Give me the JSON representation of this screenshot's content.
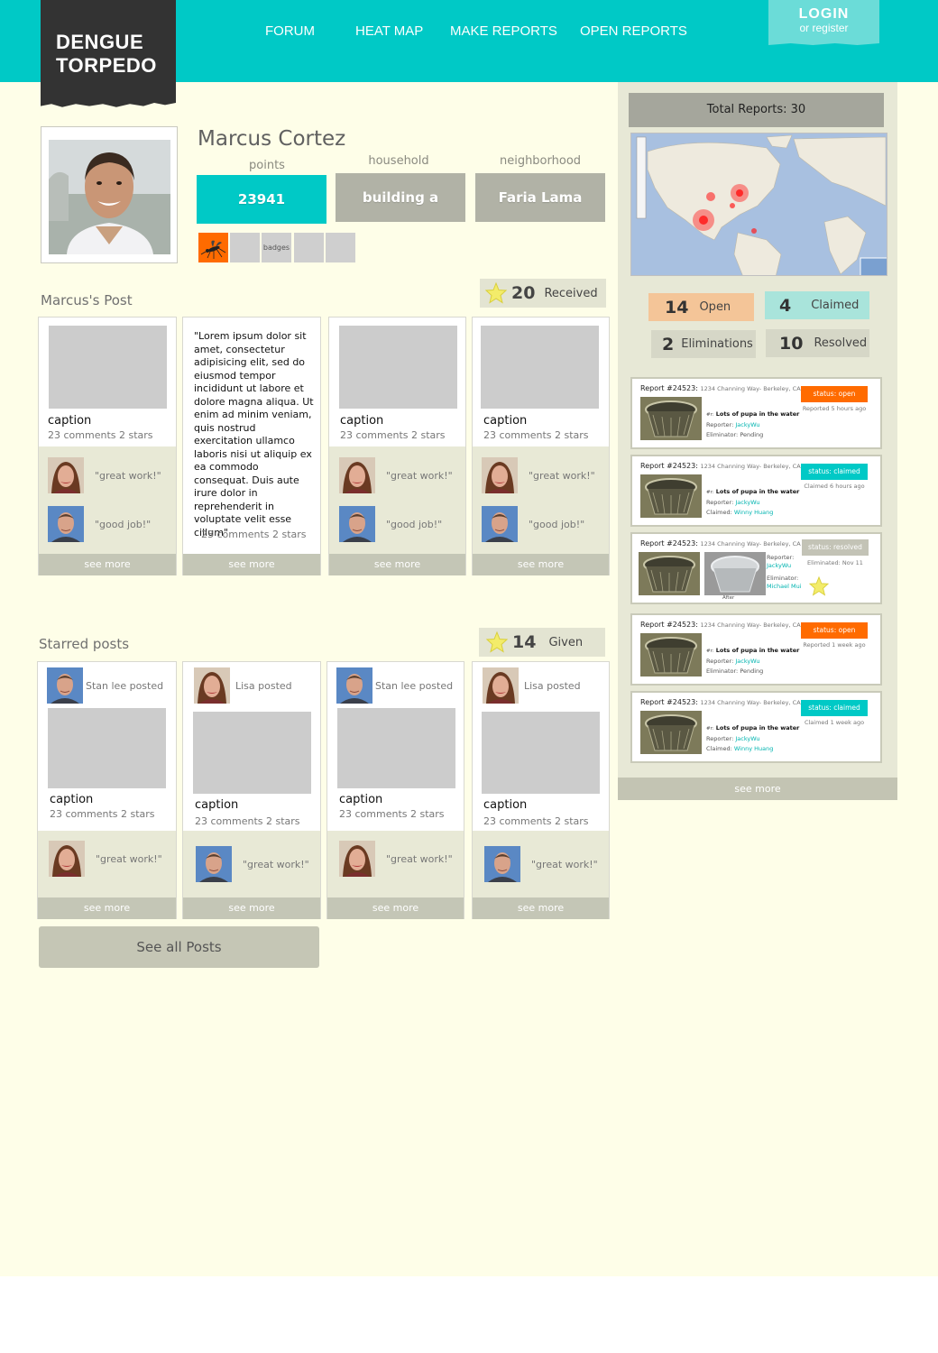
{
  "header": {
    "logo_line1": "DENGUE",
    "logo_line2": "TORPEDO",
    "nav": [
      "FORUM",
      "HEAT MAP",
      "MAKE REPORTS",
      "OPEN REPORTS"
    ],
    "login_label": "LOGIN",
    "register_label": "or register"
  },
  "profile": {
    "name": "Marcus Cortez",
    "points_label": "points",
    "points_value": "23941",
    "household_label": "household",
    "household_value": "building a",
    "neighborhood_label": "neighborhood",
    "neighborhood_value": "Faria Lama",
    "badges_label": "badges"
  },
  "posts_section": {
    "title": "Marcus's Post",
    "received_count": "20",
    "received_label": "Received"
  },
  "posts": [
    {
      "caption": "caption",
      "meta": "23 comments 2 stars",
      "comments": [
        "\"great work!\"",
        "\"good job!\""
      ],
      "see_more": "see more"
    },
    {
      "quote": "\"Lorem ipsum dolor sit amet, consectetur adipisicing elit, sed do eiusmod tempor incididunt ut labore et dolore magna aliqua. Ut enim ad minim veniam, quis nostrud exercitation ullamco laboris nisi ut aliquip ex ea commodo consequat. Duis aute irure dolor in reprehenderit in voluptate velit esse cillum\"",
      "meta": "23 comments 2 stars",
      "see_more": "see more"
    },
    {
      "caption": "caption",
      "meta": "23 comments 2 stars",
      "comments": [
        "\"great work!\"",
        "\"good job!\""
      ],
      "see_more": "see more"
    },
    {
      "caption": "caption",
      "meta": "23 comments 2 stars",
      "comments": [
        "\"great work!\"",
        "\"good job!\""
      ],
      "see_more": "see more"
    }
  ],
  "starred_section": {
    "title": "Starred posts",
    "given_count": "14",
    "given_label": "Given"
  },
  "starred": [
    {
      "poster": "Stan lee posted",
      "caption": "caption",
      "meta": "23 comments 2 stars",
      "comment": "\"great work!\"",
      "see_more": "see more"
    },
    {
      "poster": "Lisa posted",
      "caption": "caption",
      "meta": "23 comments 2 stars",
      "comment": "\"great work!\"",
      "see_more": "see more"
    },
    {
      "poster": "Stan lee posted",
      "caption": "caption",
      "meta": "23 comments 2 stars",
      "comment": "\"great work!\"",
      "see_more": "see more"
    },
    {
      "poster": "Lisa posted",
      "caption": "caption",
      "meta": "23 comments 2 stars",
      "comment": "\"great work!\"",
      "see_more": "see more"
    }
  ],
  "see_all_posts": "See all Posts",
  "sidebar": {
    "total_reports": "Total Reports: 30",
    "status": {
      "open_count": "14",
      "open_label": "Open",
      "claimed_count": "4",
      "claimed_label": "Claimed",
      "elim_count": "2",
      "elim_label": "Eliminations",
      "resolved_count": "10",
      "resolved_label": "Resolved"
    },
    "reports": [
      {
        "title": "Report #24523:",
        "address": "1234 Channing Way- Berkeley, CA",
        "status": "status: open",
        "when": "Reported 5 hours ago",
        "desc": "Lots of pupa in the water",
        "reporter_label": "Reporter:",
        "reporter": "JackyWu",
        "second_label": "Eliminator:",
        "second": "Pending"
      },
      {
        "title": "Report #24523:",
        "address": "1234 Channing Way- Berkeley, CA",
        "status": "status: claimed",
        "when": "Claimed 6 hours ago",
        "desc": "Lots of pupa in the water",
        "reporter_label": "Reporter:",
        "reporter": "JackyWu",
        "second_label": "Claimed:",
        "second": "Winny Huang"
      },
      {
        "title": "Report #24523:",
        "address": "1234 Channing Way- Berkeley, CA",
        "status": "status: resolved",
        "when": "Eliminated: Nov 11",
        "after_label": "After",
        "reporter_label": "Reporter:",
        "reporter": "JackyWu",
        "second_label": "Eliminator:",
        "second": "Michael Mui"
      },
      {
        "title": "Report #24523:",
        "address": "1234 Channing Way- Berkeley, CA",
        "status": "status: open",
        "when": "Reported 1 week ago",
        "desc": "Lots of pupa in the water",
        "reporter_label": "Reporter:",
        "reporter": "JackyWu",
        "second_label": "Eliminator:",
        "second": "Pending"
      },
      {
        "title": "Report #24523:",
        "address": "1234 Channing Way- Berkeley, CA",
        "status": "status: claimed",
        "when": "Claimed 1 week ago",
        "desc": "Lots of pupa in the water",
        "reporter_label": "Reporter:",
        "reporter": "JackyWu",
        "second_label": "Claimed:",
        "second": "Winny Huang"
      }
    ],
    "see_more": "see more"
  }
}
